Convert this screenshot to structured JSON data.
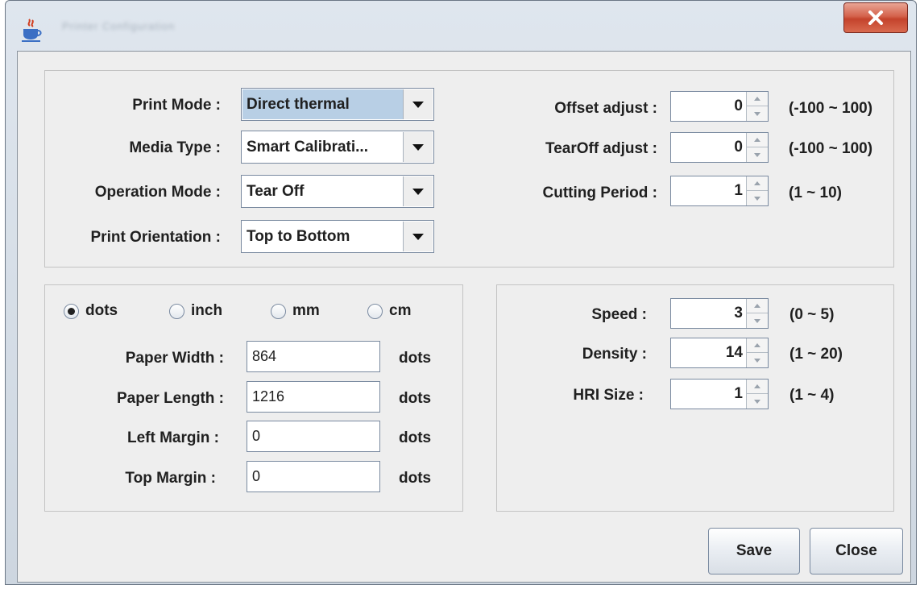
{
  "window": {
    "title": "Printer Configuration",
    "close_glyph": "X"
  },
  "print_settings": {
    "print_mode": {
      "label": "Print Mode :",
      "value": "Direct thermal"
    },
    "media_type": {
      "label": "Media Type :",
      "value": "Smart Calibrati..."
    },
    "operation_mode": {
      "label": "Operation Mode :",
      "value": "Tear Off"
    },
    "print_orientation": {
      "label": "Print Orientation :",
      "value": "Top to Bottom"
    }
  },
  "adjustments": {
    "offset": {
      "label": "Offset adjust :",
      "value": "0",
      "range": "(-100 ~ 100)"
    },
    "tearoff": {
      "label": "TearOff adjust :",
      "value": "0",
      "range": "(-100 ~ 100)"
    },
    "cutting": {
      "label": "Cutting Period :",
      "value": "1",
      "range": "(1 ~ 10)"
    }
  },
  "units": {
    "options": [
      "dots",
      "inch",
      "mm",
      "cm"
    ],
    "selected": "dots"
  },
  "paper": {
    "width": {
      "label": "Paper Width :",
      "value": "864",
      "unit": "dots"
    },
    "length": {
      "label": "Paper Length :",
      "value": "1216",
      "unit": "dots"
    },
    "left_margin": {
      "label": "Left Margin :",
      "value": "0",
      "unit": "dots"
    },
    "top_margin": {
      "label": "Top Margin :",
      "value": "0",
      "unit": "dots"
    }
  },
  "quality": {
    "speed": {
      "label": "Speed :",
      "value": "3",
      "range": "(0 ~ 5)"
    },
    "density": {
      "label": "Density :",
      "value": "14",
      "range": "(1 ~ 20)"
    },
    "hri_size": {
      "label": "HRI Size :",
      "value": "1",
      "range": "(1 ~ 4)"
    }
  },
  "buttons": {
    "save": "Save",
    "close": "Close"
  },
  "icons": {
    "app": "java-cup-icon",
    "dropdown": "triangle-down-icon"
  }
}
